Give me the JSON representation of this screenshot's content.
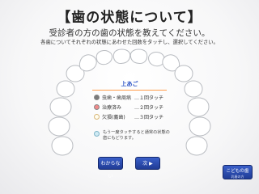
{
  "header": {
    "title": "【歯の状態について】",
    "subtitle": "受診者の方の歯の状態を教えてください。",
    "instruction": "各歯についてそれぞれの状態にあわせた回数をタッチし、選択してください。"
  },
  "panel": {
    "jaw_label": "上あご",
    "legend": [
      {
        "label": "虫歯・歯周病",
        "action": "…１回タッチ",
        "color": "#7a7a7a"
      },
      {
        "label": "治療済み",
        "action": "…２回タッチ",
        "color": "#f08a8a"
      },
      {
        "label": "欠損(義歯)",
        "action": "…３回タッチ",
        "color": "#fffdf0"
      }
    ],
    "note": "もう一度タッチすると通常の状態の歯にもどります。"
  },
  "buttons": {
    "unknown": "わからない",
    "next": "次 ▶",
    "child_line1": "こどもの歯",
    "child_line2": "乳歯の方"
  },
  "teeth": {
    "count": 16,
    "state": "normal",
    "colors": {
      "normal_fill": "#ffffff",
      "outline": "#b9bcc1"
    }
  }
}
